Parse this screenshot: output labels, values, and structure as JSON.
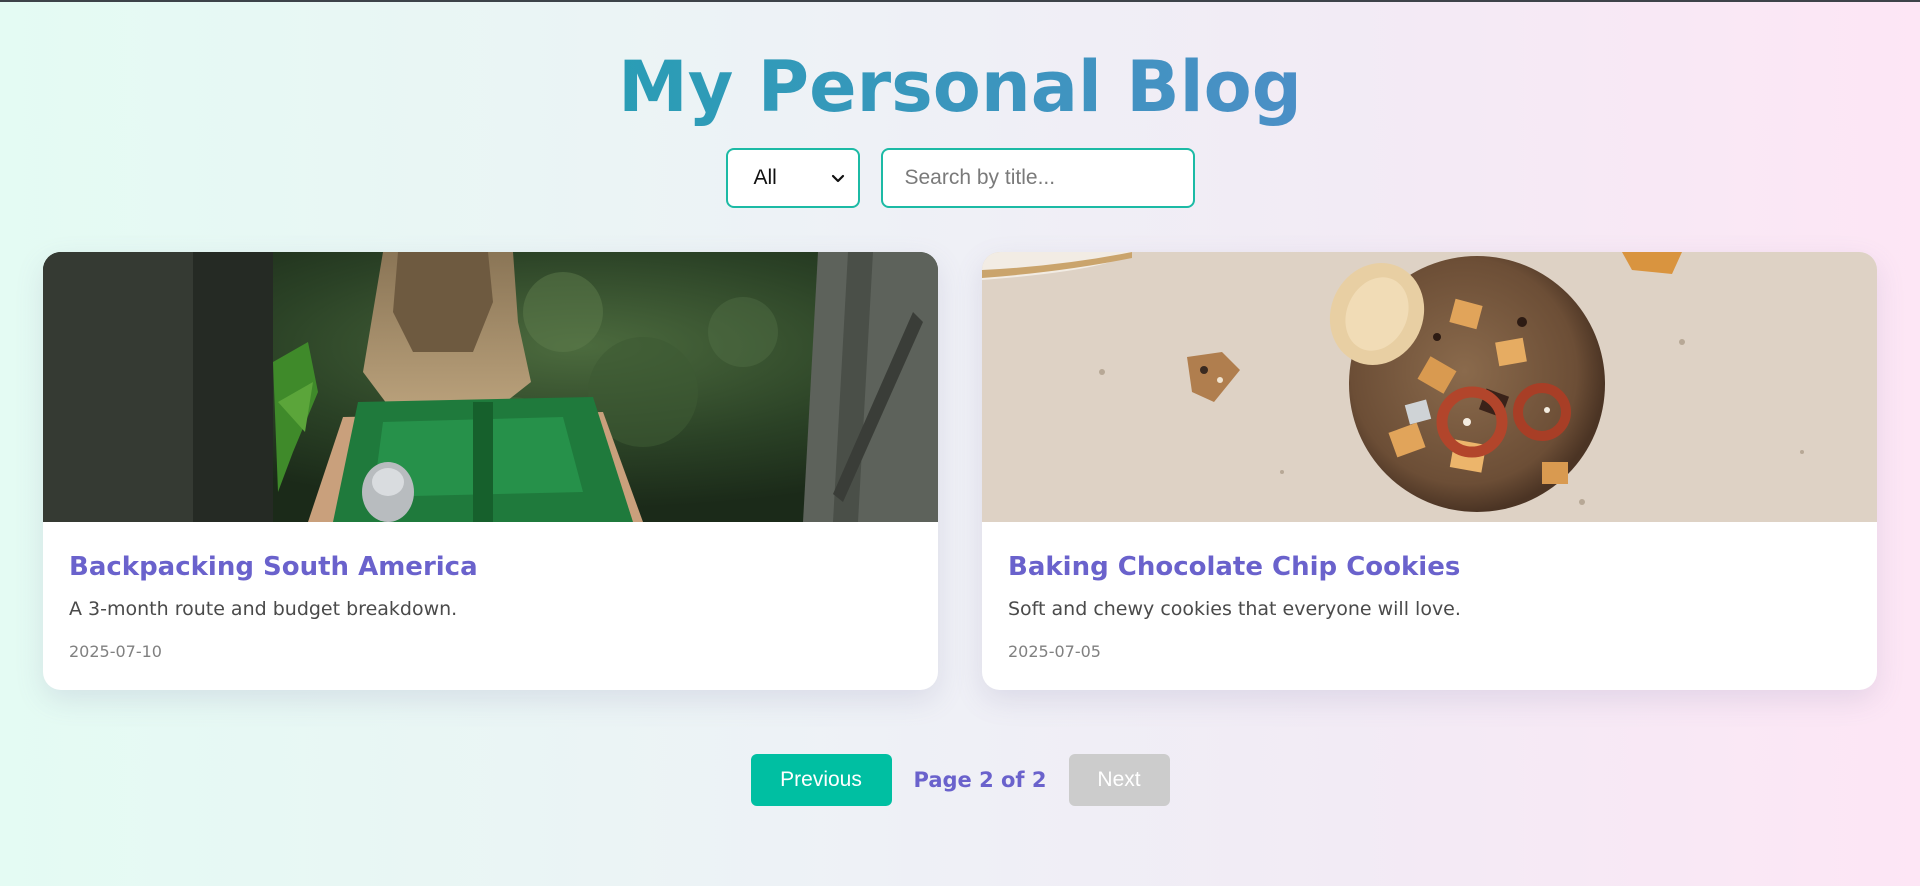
{
  "header": {
    "title": "My Personal Blog"
  },
  "filters": {
    "category_selected": "All",
    "search_placeholder": "Search by title...",
    "search_value": ""
  },
  "posts": [
    {
      "title": "Backpacking South America",
      "description": "A 3-month route and budget breakdown.",
      "date": "2025-07-10",
      "image_subject": "hiker with green backpack in forest"
    },
    {
      "title": "Baking Chocolate Chip Cookies",
      "description": "Soft and chewy cookies that everyone will love.",
      "date": "2025-07-05",
      "image_subject": "cookie with pretzels and chips on stone surface"
    }
  ],
  "pagination": {
    "previous_label": "Previous",
    "page_info": "Page 2 of 2",
    "next_label": "Next",
    "current_page": 2,
    "total_pages": 2
  },
  "colors": {
    "accent": "#00bfa2",
    "title_gradient_start": "#2a9db5",
    "title_gradient_end": "#4b8fc6",
    "post_title": "#6a62cc",
    "disabled": "#cccccc"
  }
}
